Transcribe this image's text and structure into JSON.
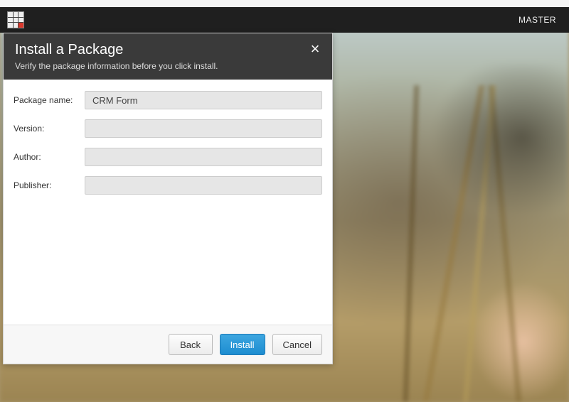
{
  "navbar": {
    "user": "MASTER"
  },
  "dialog": {
    "title": "Install a Package",
    "subtitle": "Verify the package information before you click install.",
    "fields": {
      "package_name": {
        "label": "Package name:",
        "value": "CRM Form"
      },
      "version": {
        "label": "Version:",
        "value": ""
      },
      "author": {
        "label": "Author:",
        "value": ""
      },
      "publisher": {
        "label": "Publisher:",
        "value": ""
      }
    },
    "buttons": {
      "back": "Back",
      "install": "Install",
      "cancel": "Cancel"
    },
    "close_label": "×"
  }
}
